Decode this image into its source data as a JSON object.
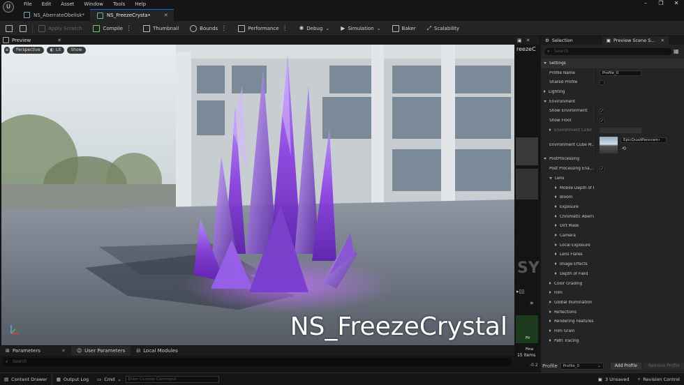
{
  "menu": {
    "items": [
      "File",
      "Edit",
      "Asset",
      "Window",
      "Tools",
      "Help"
    ]
  },
  "tabs": [
    {
      "label": "NS_AberrateObelisk*"
    },
    {
      "label": "NS_FreezeCrysta•"
    }
  ],
  "toolbar": {
    "apply_scratch": "Apply Scratch",
    "compile": "Compile",
    "thumbnail": "Thumbnail",
    "bounds": "Bounds",
    "performance": "Performance",
    "debug": "Debug",
    "simulation": "Simulation",
    "baker": "Baker",
    "scalability": "Scalability"
  },
  "preview": {
    "tab_label": "Preview",
    "perspective": "Perspective",
    "lit": "Lit",
    "show": "Show",
    "overlay_title": "NS_FreezeCrystal"
  },
  "bottom_panel": {
    "tabs": [
      "Parameters",
      "User Parameters",
      "Local Modules"
    ],
    "search_placeholder": "Search"
  },
  "mini_panel": {
    "title": "reezeC",
    "items_label": "15 items",
    "value": "-0.2",
    "list": [
      "Fir",
      "Fina"
    ]
  },
  "right_panel": {
    "tabs": [
      "Selection",
      "Preview Scene S..."
    ],
    "search_placeholder": "Search",
    "props": [
      {
        "label": "Settings",
        "type": "cat",
        "arrow": "down",
        "indent": 0
      },
      {
        "label": "Profile Name",
        "indent": 1,
        "value": "Profile_0"
      },
      {
        "label": "Shared Profile",
        "indent": 1,
        "check": ""
      },
      {
        "label": "Lighting",
        "indent": 0,
        "arrow": "right"
      },
      {
        "label": "Environment",
        "indent": 0,
        "arrow": "down"
      },
      {
        "label": "Show Environment",
        "indent": 1,
        "check": "✓"
      },
      {
        "label": "Show Floor",
        "indent": 1,
        "check": "✓"
      },
      {
        "label": "Environment Color",
        "indent": 1,
        "arrow": "right",
        "dim": true
      },
      {
        "label": "Environment Cube M...",
        "indent": 1,
        "cube": "EpicQuadPanoramı"
      },
      {
        "label": "PostProcessing",
        "indent": 0,
        "arrow": "down"
      },
      {
        "label": "Post Processing Ena...",
        "indent": 1,
        "check": "✓"
      },
      {
        "label": "Lens",
        "indent": 1,
        "arrow": "down"
      },
      {
        "label": "Mobile Depth of Fie",
        "indent": 2,
        "arrow": "right"
      },
      {
        "label": "Bloom",
        "indent": 2,
        "arrow": "right"
      },
      {
        "label": "Exposure",
        "indent": 2,
        "arrow": "right"
      },
      {
        "label": "Chromatic Aberrati",
        "indent": 2,
        "arrow": "right"
      },
      {
        "label": "Dirt Mask",
        "indent": 2,
        "arrow": "right"
      },
      {
        "label": "Camera",
        "indent": 2,
        "arrow": "right"
      },
      {
        "label": "Local Exposure",
        "indent": 2,
        "arrow": "right"
      },
      {
        "label": "Lens Flares",
        "indent": 2,
        "arrow": "right"
      },
      {
        "label": "Image Effects",
        "indent": 2,
        "arrow": "right"
      },
      {
        "label": "Depth of Field",
        "indent": 2,
        "arrow": "right"
      },
      {
        "label": "Color Grading",
        "indent": 1,
        "arrow": "right"
      },
      {
        "label": "Film",
        "indent": 1,
        "arrow": "right"
      },
      {
        "label": "Global Illumination",
        "indent": 1,
        "arrow": "right"
      },
      {
        "label": "Reflections",
        "indent": 1,
        "arrow": "right"
      },
      {
        "label": "Rendering Features",
        "indent": 1,
        "arrow": "right"
      },
      {
        "label": "Film Grain",
        "indent": 1,
        "arrow": "right"
      },
      {
        "label": "Path Tracing",
        "indent": 1,
        "arrow": "right"
      }
    ],
    "profile_label": "Profile",
    "profile_value": "Profile_0",
    "add_profile": "Add Profile",
    "remove_profile": "Remove Profile"
  },
  "statusbar": {
    "content_drawer": "Content Drawer",
    "output_log": "Output Log",
    "cmd": "Cmd",
    "console_placeholder": "Enter Console Command",
    "unsaved": "3 Unsaved",
    "revision": "Revision Control"
  },
  "colors": {
    "accent": "#0070e0",
    "crystal": "#9a4cff"
  }
}
